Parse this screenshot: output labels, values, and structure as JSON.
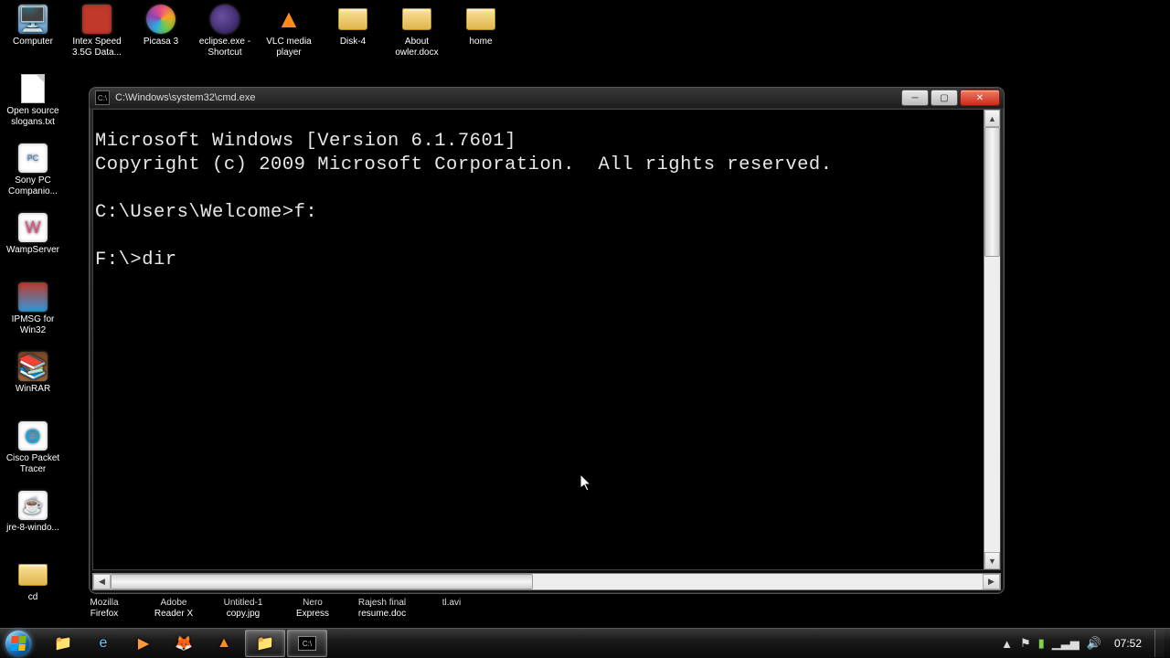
{
  "desktop": {
    "col1": [
      {
        "label": "Computer",
        "glyph": "computer"
      },
      {
        "label": "Open source slogans.txt",
        "glyph": "file"
      },
      {
        "label": "Sony PC Companio...",
        "glyph": "sony"
      },
      {
        "label": "WampServer",
        "glyph": "wamp"
      },
      {
        "label": "IPMSG for Win32",
        "glyph": "ipmsg"
      },
      {
        "label": "WinRAR",
        "glyph": "winrar"
      },
      {
        "label": "Cisco Packet Tracer",
        "glyph": "cisco"
      },
      {
        "label": "jre-8-windo...",
        "glyph": "java"
      },
      {
        "label": "cd",
        "glyph": "folder"
      }
    ],
    "row1": [
      {
        "label": "Intex Speed 3.5G Data...",
        "glyph": "intex"
      },
      {
        "label": "Picasa 3",
        "glyph": "picasa"
      },
      {
        "label": "eclipse.exe - Shortcut",
        "glyph": "eclipse"
      },
      {
        "label": "VLC media player",
        "glyph": "vlc"
      },
      {
        "label": "Disk-4",
        "glyph": "folder"
      },
      {
        "label": "About owler.docx",
        "glyph": "folder"
      },
      {
        "label": "home",
        "glyph": "folder"
      }
    ],
    "bottom_labels": [
      "Mozilla Firefox",
      "Adobe Reader X",
      "Untitled-1 copy.jpg",
      "Nero Express",
      "Rajesh final resume.doc",
      "tl.avi"
    ]
  },
  "cmd": {
    "title": "C:\\Windows\\system32\\cmd.exe",
    "lines": [
      "Microsoft Windows [Version 6.1.7601]",
      "Copyright (c) 2009 Microsoft Corporation.  All rights reserved.",
      "",
      "C:\\Users\\Welcome>f:",
      "",
      "F:\\>dir"
    ]
  },
  "tray": {
    "show_hidden": "▲",
    "clock": "07:52"
  }
}
